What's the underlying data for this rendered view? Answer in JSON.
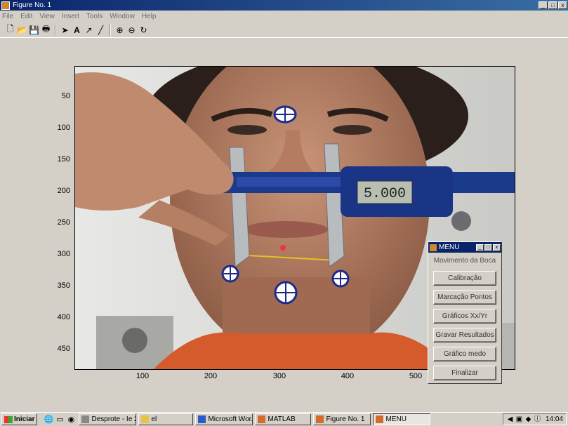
{
  "window": {
    "title": "Figure No. 1"
  },
  "menubar": [
    "File",
    "Edit",
    "View",
    "Insert",
    "Tools",
    "Window",
    "Help"
  ],
  "toolbar": {
    "icons": [
      "new-file-icon",
      "open-folder-icon",
      "save-icon",
      "print-icon",
      "select-arrow-icon",
      "text-icon",
      "arrow-icon",
      "line-icon",
      "zoom-in-icon",
      "zoom-out-icon",
      "rotate-icon"
    ]
  },
  "axes": {
    "yticks": [
      "50",
      "100",
      "150",
      "200",
      "250",
      "300",
      "350",
      "400",
      "450"
    ],
    "xticks": [
      "100",
      "200",
      "300",
      "400",
      "500"
    ]
  },
  "caliper": {
    "display_value": "5.000"
  },
  "menu_window": {
    "title": "MENU",
    "heading": "Movimento da Boca",
    "buttons": [
      "Calibração",
      "Marcação Pontos",
      "Gráficos Xx/Yr",
      "Gravar Resultados",
      "Gráfico medo",
      "Finalizar"
    ]
  },
  "taskbar": {
    "start_label": "Iniciar",
    "tasks": [
      "Desprote - Ie 2...",
      "el",
      "Microsoft Wor...",
      "MATLAB",
      "Figure No. 1",
      "MENU"
    ],
    "active_task": "MENU",
    "clock": "14:04"
  },
  "colors": {
    "titlebar": "#0a246a",
    "face_background": "#d4d0c8"
  }
}
